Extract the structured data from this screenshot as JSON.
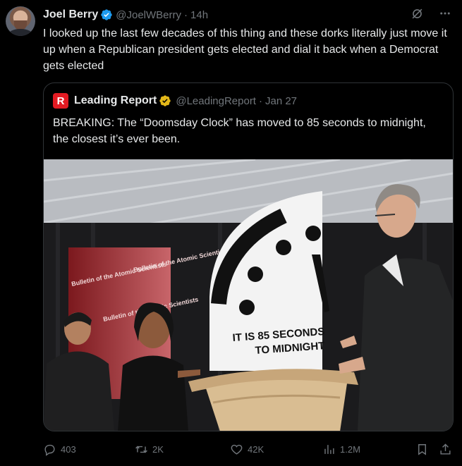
{
  "tweet": {
    "author_name": "Joel Berry",
    "handle": "@JoelWBerry",
    "separator": "·",
    "time": "14h",
    "text": "I looked up the last few decades of this thing and these dorks literally just move it up when a Republican president gets elected and dial it back when a Democrat gets elected",
    "icons": {
      "grok": "grok-icon",
      "more": "more-icon",
      "verified": "verified-blue-icon"
    },
    "accent_color": "#1d9bf0"
  },
  "quote": {
    "logo_letter": "R",
    "author_name": "Leading Report",
    "handle": "@LeadingReport",
    "separator": "·",
    "date": "Jan 27",
    "text": "BREAKING: The “Doomsday Clock” has moved to 85 seconds to midnight, the closest it’s ever been.",
    "badge_color": "#e2b719",
    "photo": {
      "clock_line1": "IT IS 85 SECONDS",
      "clock_line2": "TO MIDNIGHT",
      "banner_left": "Bulletin of the Atomic Scientists",
      "banner_right_top": "Bulletin of the Atomic Scientists",
      "banner_right_bottom": "Bulletin of the Atomic Scientists"
    }
  },
  "engagement": {
    "replies": "403",
    "reposts": "2K",
    "likes": "42K",
    "views": "1.2M",
    "icons": [
      "reply-icon",
      "repost-icon",
      "like-icon",
      "views-icon",
      "bookmark-icon",
      "share-icon"
    ]
  }
}
